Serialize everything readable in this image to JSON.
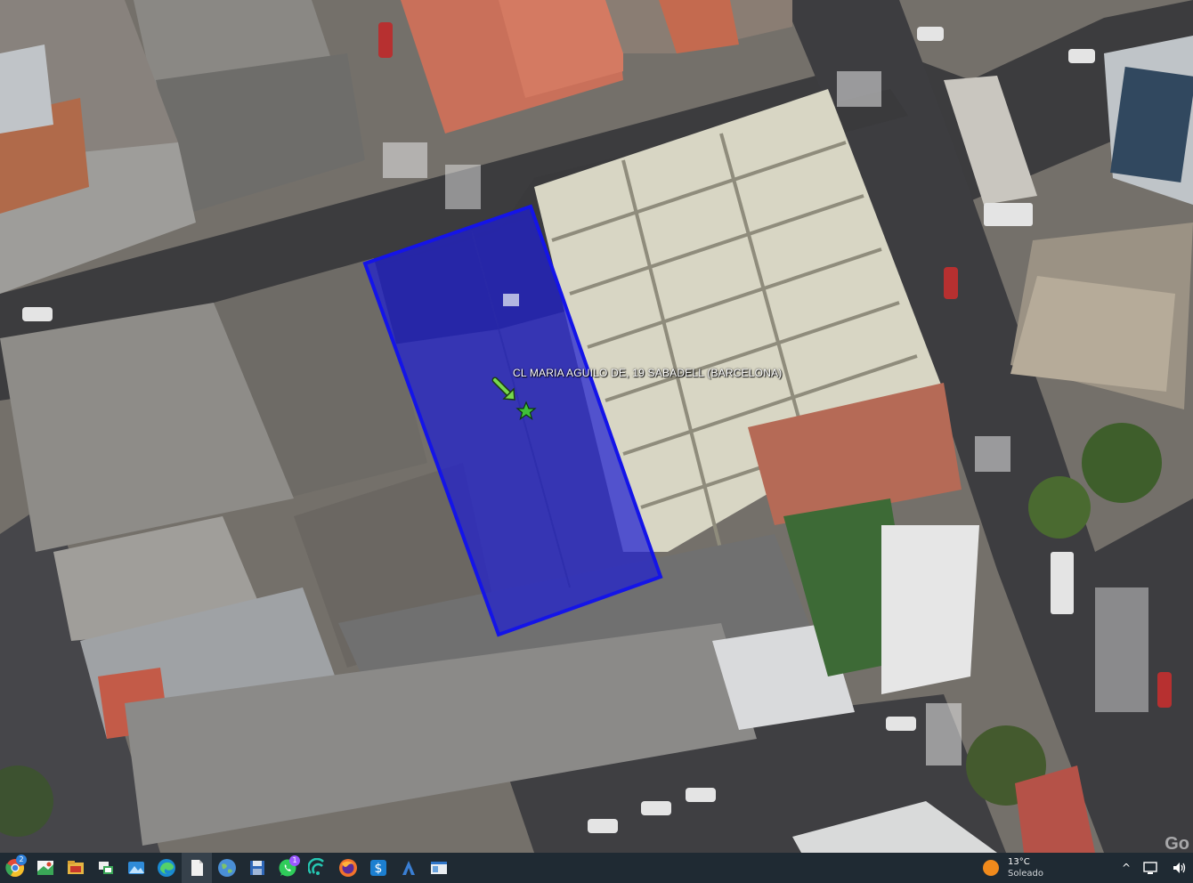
{
  "map": {
    "placemark_label": "CL MARIA AGUILO DE, 19  SABADELL (BARCELONA)",
    "placemark_icon": "star-icon",
    "pointer_icon": "arrow-icon",
    "polygon_color": "#1f1fd0",
    "watermark": "Go"
  },
  "taskbar": {
    "apps": [
      {
        "name": "chrome-icon",
        "badge": "2"
      },
      {
        "name": "maps-app-icon"
      },
      {
        "name": "file-explorer-icon"
      },
      {
        "name": "sharing-app-icon"
      },
      {
        "name": "photos-icon"
      },
      {
        "name": "edge-icon"
      },
      {
        "name": "document-icon"
      },
      {
        "name": "earth-icon"
      },
      {
        "name": "save-disk-icon"
      },
      {
        "name": "whatsapp-icon",
        "badge": "1"
      },
      {
        "name": "wifi-app-icon"
      },
      {
        "name": "firefox-icon"
      },
      {
        "name": "dollar-app-icon"
      },
      {
        "name": "autocad-icon"
      },
      {
        "name": "window-app-icon"
      }
    ],
    "weather": {
      "temperature": "13°C",
      "condition": "Soleado"
    },
    "tray": {
      "chevron": "^"
    }
  }
}
